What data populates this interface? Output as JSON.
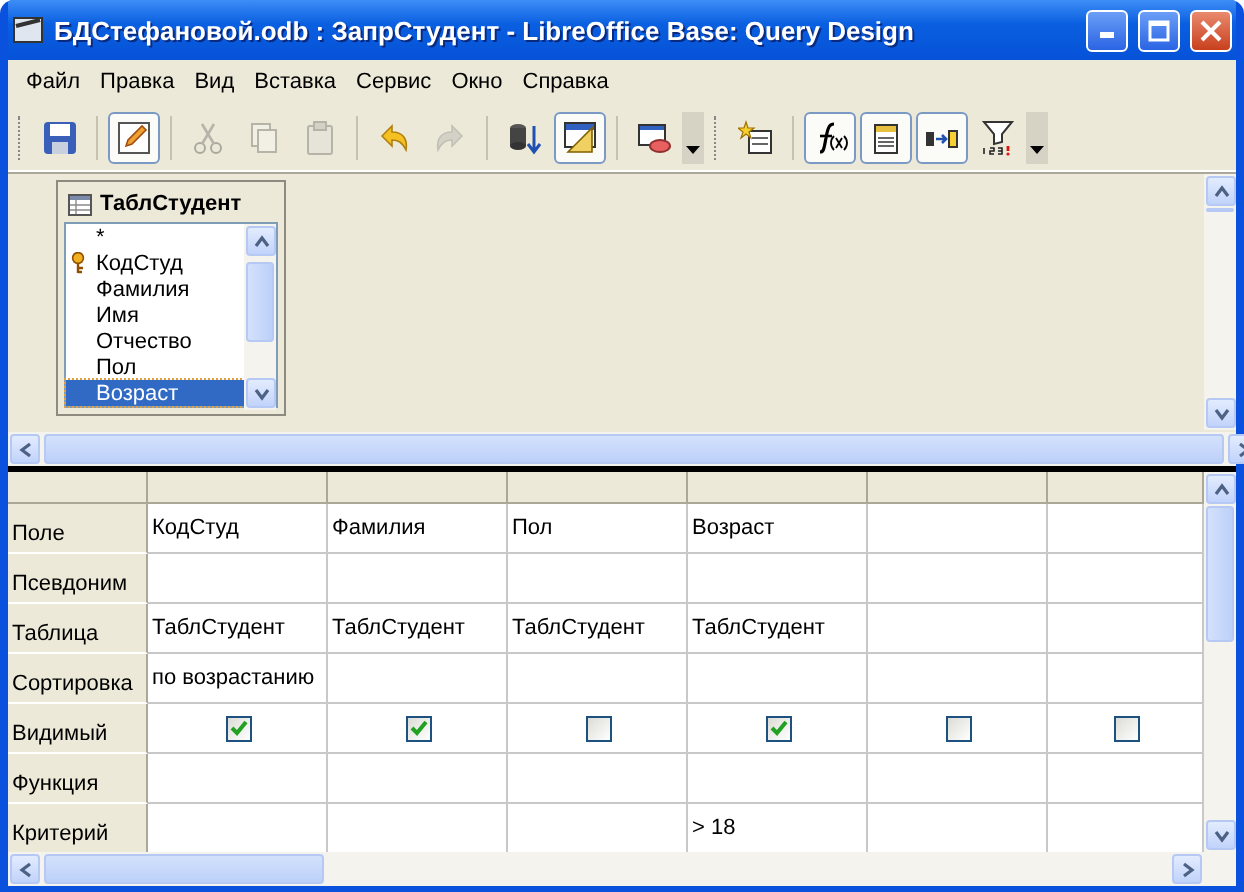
{
  "window": {
    "title": "БДСтефановой.odb : ЗапрСтудент - LibreOffice Base: Query Design"
  },
  "menu": [
    "Файл",
    "Правка",
    "Вид",
    "Вставка",
    "Сервис",
    "Окно",
    "Справка"
  ],
  "toolbars": [
    [
      [
        {
          "pressed": false,
          "disabled": false
        }
      ],
      [
        {
          "pressed": true,
          "disabled": false
        }
      ],
      [
        {
          "pressed": false,
          "disabled": true
        },
        {
          "pressed": false,
          "disabled": true
        },
        {
          "pressed": false,
          "disabled": true
        }
      ],
      [
        {
          "pressed": false,
          "disabled": false
        },
        {
          "pressed": false,
          "disabled": true
        }
      ],
      [
        {
          "pressed": false,
          "disabled": false
        },
        {
          "pressed": true,
          "disabled": false
        }
      ],
      [
        {
          "pressed": false,
          "disabled": false
        }
      ]
    ],
    [
      [
        {
          "pressed": false,
          "disabled": false
        }
      ],
      [
        {
          "pressed": true,
          "disabled": false
        },
        {
          "pressed": true,
          "disabled": false
        },
        {
          "pressed": true,
          "disabled": false
        },
        {
          "pressed": false,
          "disabled": false
        }
      ]
    ]
  ],
  "table_window": {
    "title": "ТаблСтудент",
    "fields": [
      {
        "name": "*",
        "key": false,
        "selected": false
      },
      {
        "name": "КодСтуд",
        "key": true,
        "selected": false
      },
      {
        "name": "Фамилия",
        "key": false,
        "selected": false
      },
      {
        "name": "Имя",
        "key": false,
        "selected": false
      },
      {
        "name": "Отчество",
        "key": false,
        "selected": false
      },
      {
        "name": "Пол",
        "key": false,
        "selected": false
      },
      {
        "name": "Возраст",
        "key": false,
        "selected": true
      }
    ]
  },
  "grid": {
    "rows": [
      {
        "label": "Поле",
        "kind": "text",
        "cells": [
          "КодСтуд",
          "Фамилия",
          "Пол",
          "Возраст",
          null,
          null
        ]
      },
      {
        "label": "Псевдоним",
        "kind": "text",
        "cells": [
          null,
          null,
          null,
          null,
          null,
          null
        ]
      },
      {
        "label": "Таблица",
        "kind": "text",
        "cells": [
          "ТаблСтудент",
          "ТаблСтудент",
          "ТаблСтудент",
          "ТаблСтудент",
          null,
          null
        ]
      },
      {
        "label": "Сортировка",
        "kind": "text",
        "cells": [
          "по возрастанию",
          null,
          null,
          null,
          null,
          null
        ]
      },
      {
        "label": "Видимый",
        "kind": "checkbox",
        "cells": [
          {
            "checked": true
          },
          {
            "checked": true
          },
          {
            "checked": false
          },
          {
            "checked": true
          },
          {
            "checked": false
          },
          {
            "checked": false
          }
        ]
      },
      {
        "label": "Функция",
        "kind": "text",
        "cells": [
          null,
          null,
          null,
          null,
          null,
          null
        ]
      },
      {
        "label": "Критерий",
        "kind": "text",
        "cells": [
          null,
          null,
          null,
          "> 18",
          null,
          null
        ]
      }
    ]
  }
}
